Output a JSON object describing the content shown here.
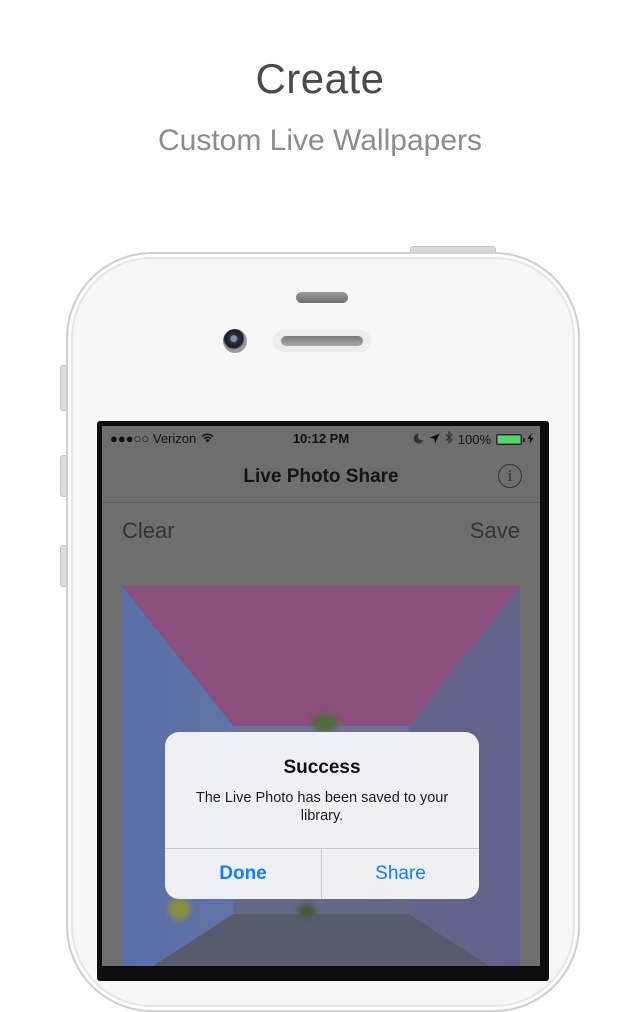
{
  "header": {
    "title": "Create",
    "subtitle": "Custom Live Wallpapers"
  },
  "status_bar": {
    "carrier": "●●●○○ Verizon",
    "time": "10:12 PM",
    "battery_percent": "100%",
    "battery_level": 1.0
  },
  "nav": {
    "title": "Live Photo Share",
    "info_icon": "info-icon",
    "info_glyph": "i"
  },
  "toolbar": {
    "clear_label": "Clear",
    "save_label": "Save"
  },
  "alert": {
    "title": "Success",
    "message": "The Live Photo has been saved to your library.",
    "done_label": "Done",
    "share_label": "Share"
  },
  "colors": {
    "accent_blue": "#147efb",
    "battery_green": "#4cd964",
    "dim_overlay": "#6e6e6e"
  }
}
